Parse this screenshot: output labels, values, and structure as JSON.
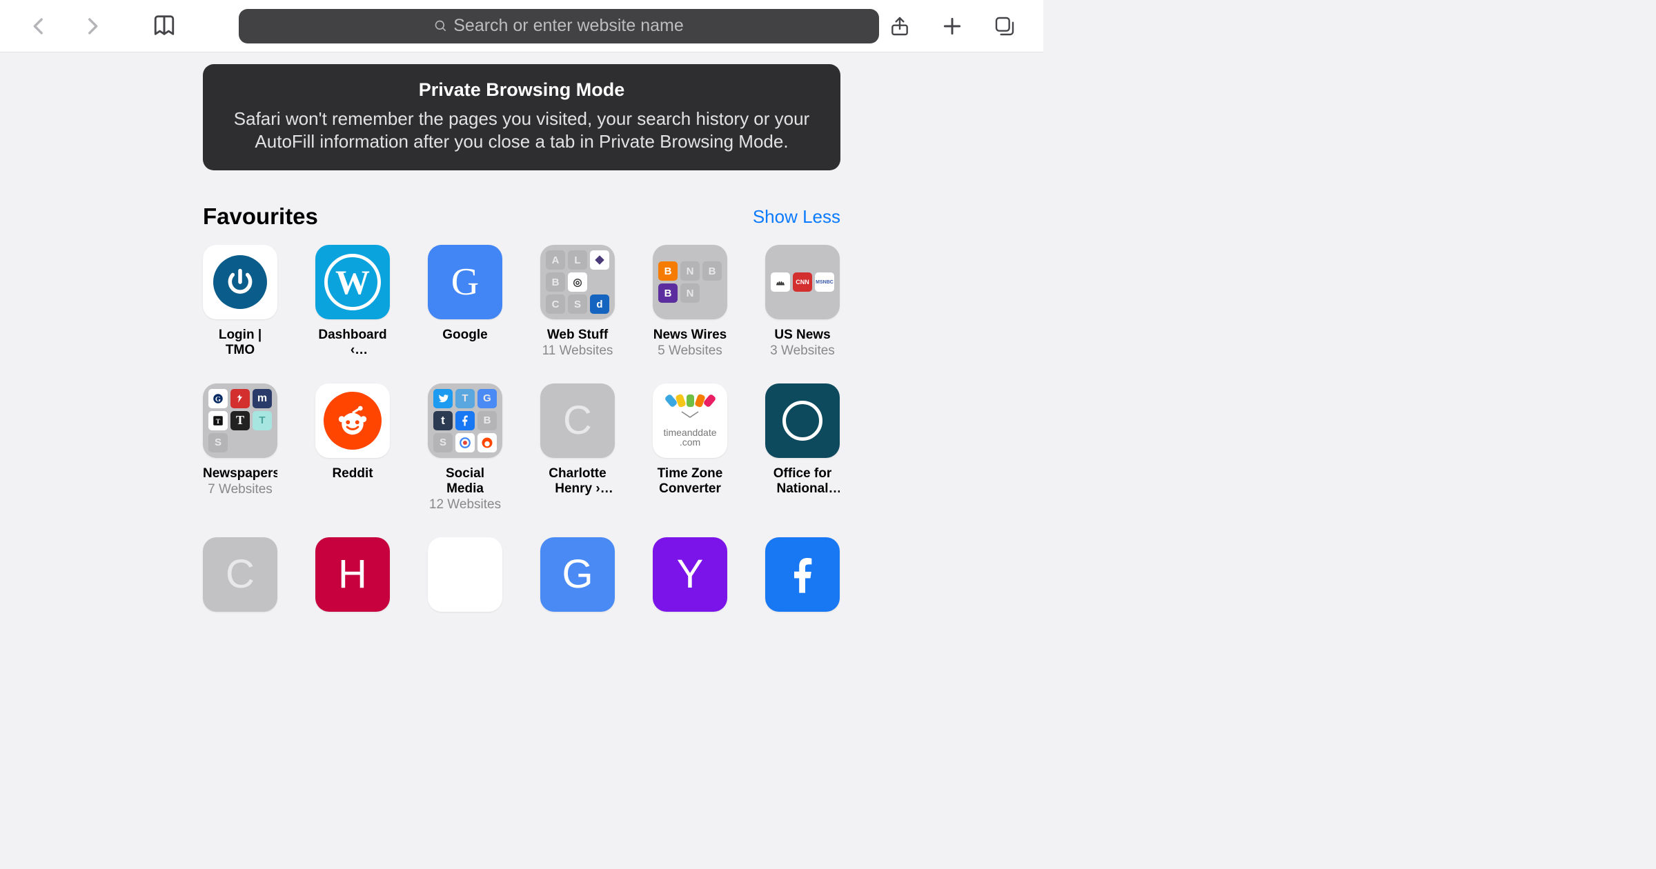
{
  "toolbar": {
    "search_placeholder": "Search or enter website name"
  },
  "private_banner": {
    "title": "Private Browsing Mode",
    "body": "Safari won't remember the pages you visited, your search history or your AutoFill information after you close a tab in Private Browsing Mode."
  },
  "favourites": {
    "heading": "Favourites",
    "show_less": "Show Less"
  },
  "tiles": [
    {
      "title": "Login | TMO",
      "sub": ""
    },
    {
      "title": "Dashboard ‹ Charlotte…",
      "sub": ""
    },
    {
      "title": "Google",
      "sub": ""
    },
    {
      "title": "Web Stuff",
      "sub": "11 Websites"
    },
    {
      "title": "News Wires",
      "sub": "5 Websites"
    },
    {
      "title": "US News",
      "sub": "3 Websites"
    },
    {
      "title": "Newspapers",
      "sub": "7 Websites"
    },
    {
      "title": "Reddit",
      "sub": ""
    },
    {
      "title": "Social Media",
      "sub": "12 Websites"
    },
    {
      "title": "Charlotte Henry › Lo…",
      "sub": ""
    },
    {
      "title": "Time Zone Converter",
      "sub": ""
    },
    {
      "title": "Office for National St…",
      "sub": ""
    },
    {
      "title": "C",
      "sub": ""
    },
    {
      "title": "H",
      "sub": ""
    },
    {
      "title": "",
      "sub": ""
    },
    {
      "title": "G",
      "sub": ""
    },
    {
      "title": "Y",
      "sub": ""
    },
    {
      "title": "f",
      "sub": ""
    }
  ],
  "folder_minis": {
    "webstuff": [
      "A",
      "L",
      "◆",
      "B",
      "◎",
      "",
      "C",
      "S",
      "d"
    ],
    "newswires": [
      "B",
      "N",
      "B",
      "B",
      "N"
    ],
    "usnews": [
      "✱",
      "CNN",
      "MS"
    ],
    "newspapers": [
      "G",
      "✱",
      "m",
      "T",
      "T",
      "T",
      "S"
    ],
    "social": [
      "t",
      "T",
      "G",
      "t",
      "f",
      "B",
      "S",
      "◎",
      "◎"
    ]
  },
  "tad_label": "timeanddate\n.com"
}
